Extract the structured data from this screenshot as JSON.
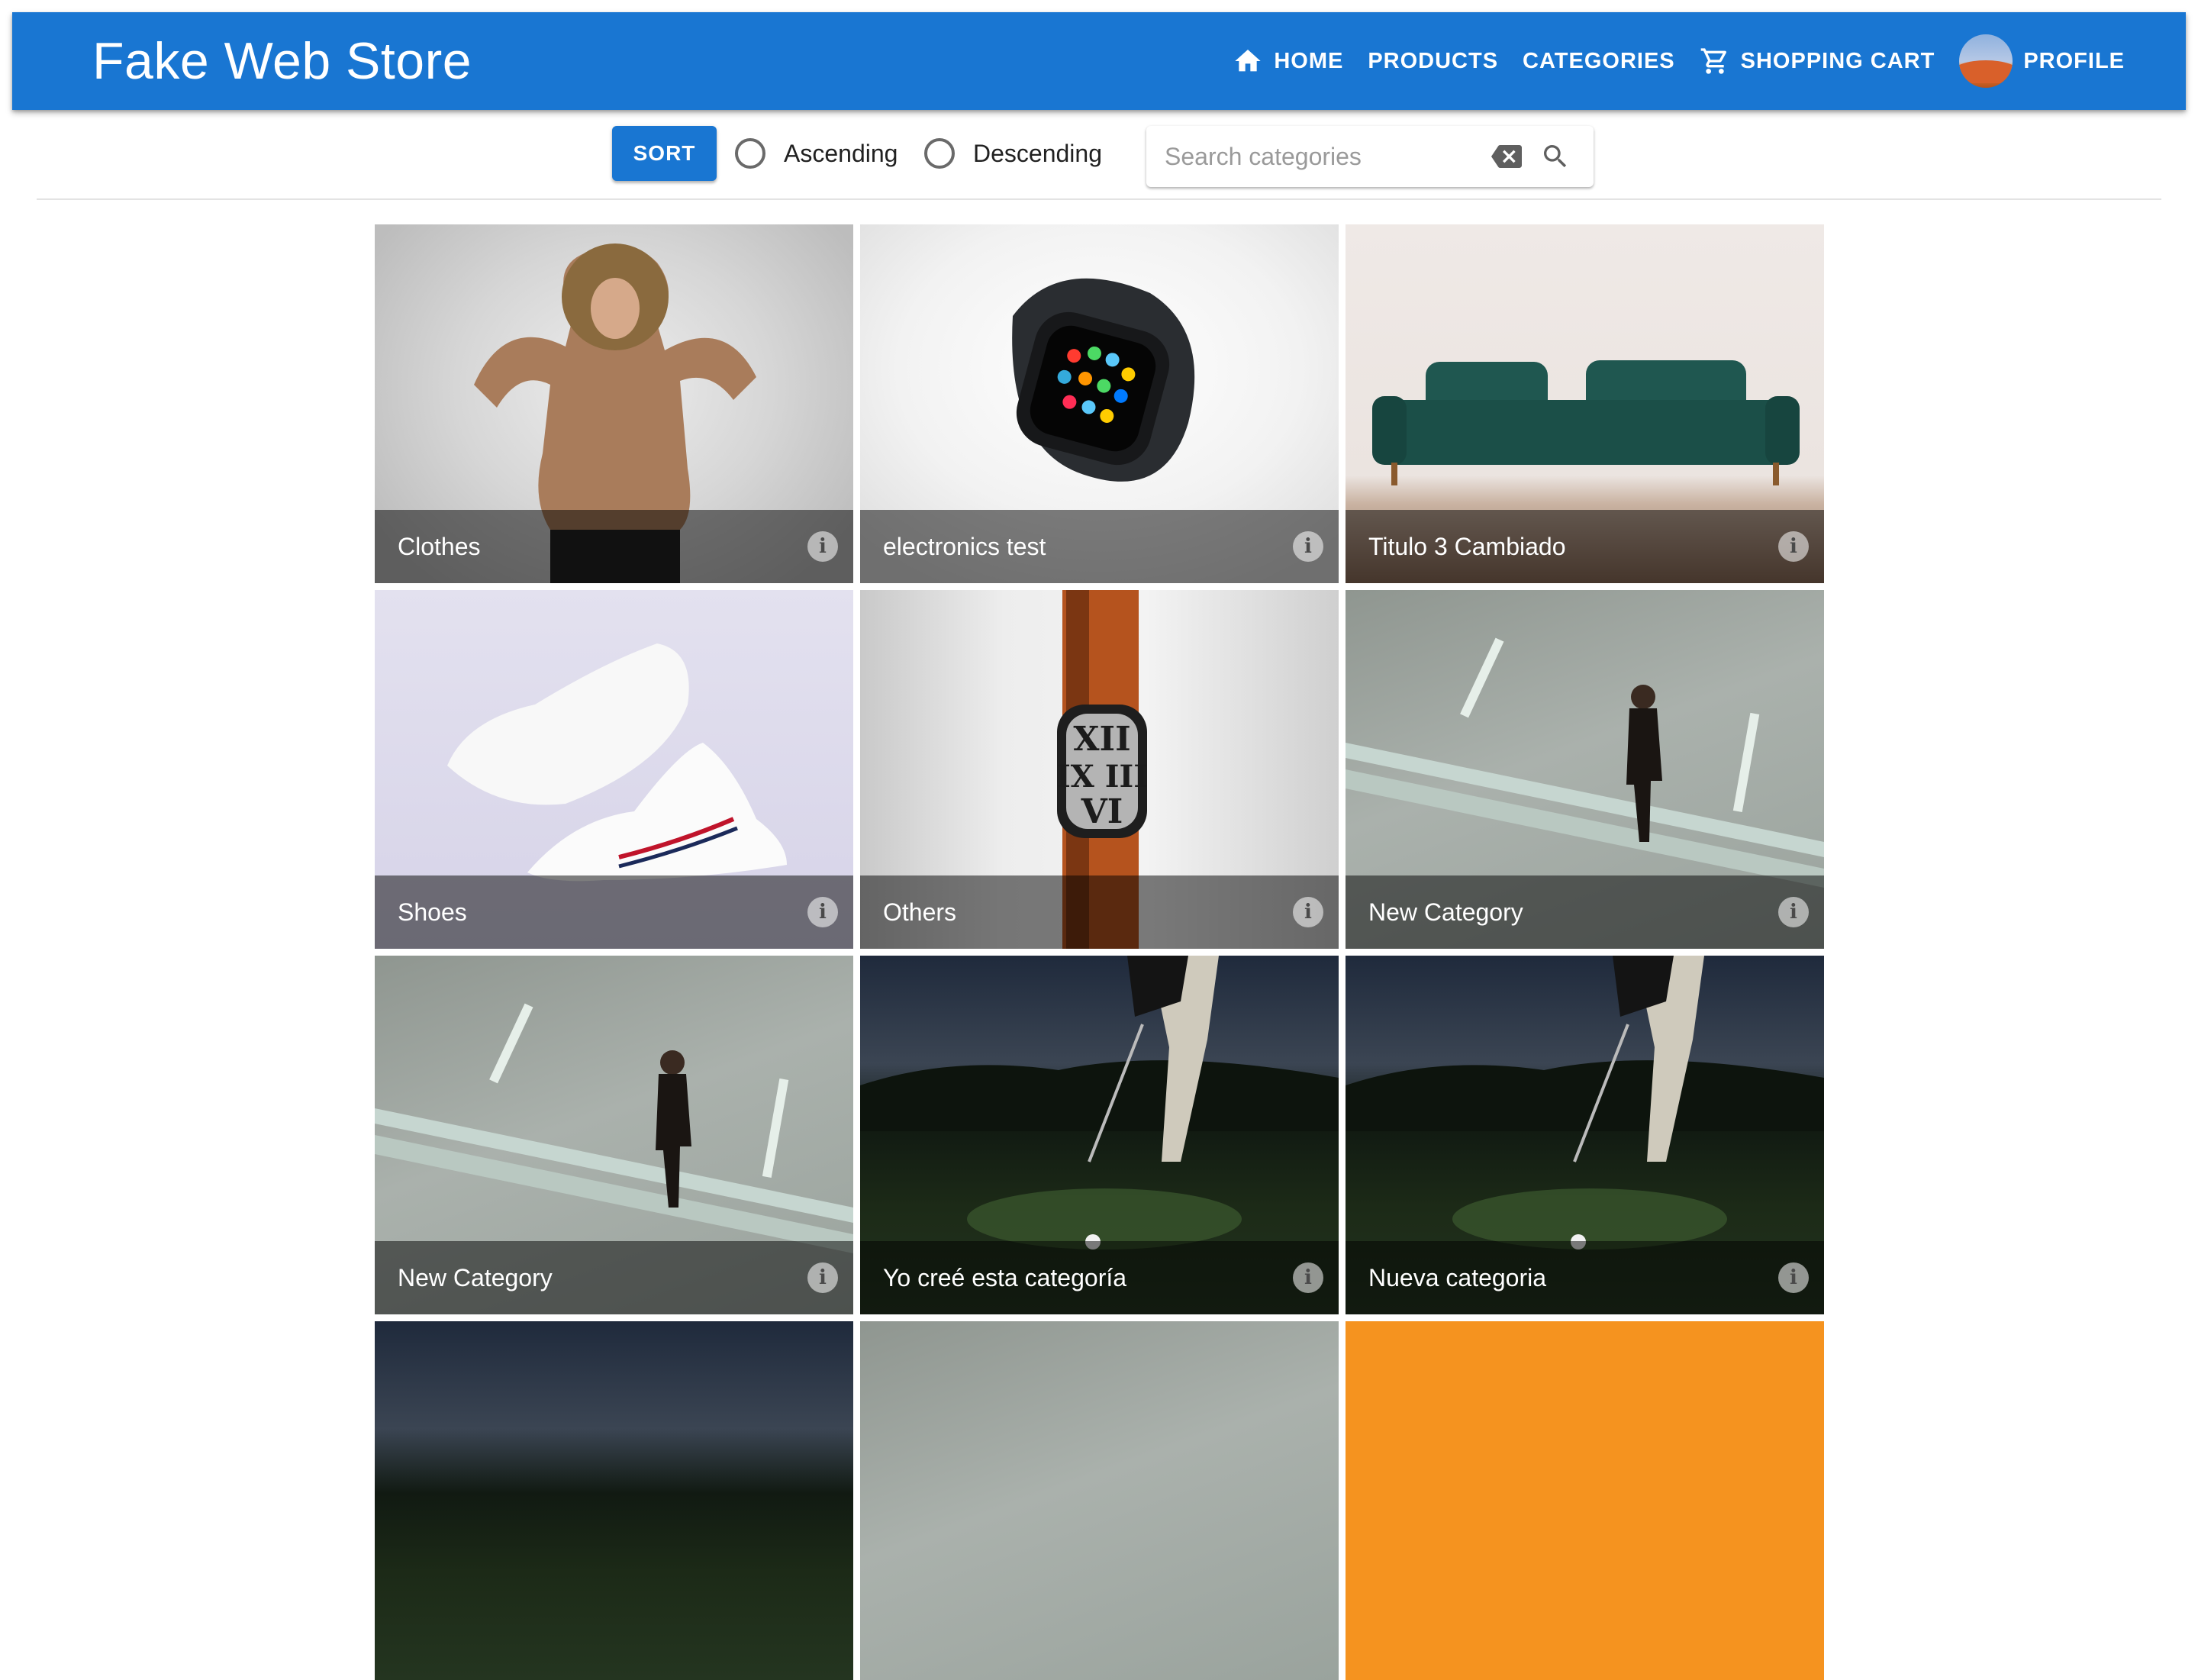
{
  "app": {
    "title": "Fake Web Store"
  },
  "nav": {
    "home": "HOME",
    "products": "PRODUCTS",
    "categories": "CATEGORIES",
    "cart": "SHOPPING CART",
    "profile": "PROFILE"
  },
  "toolbar": {
    "sort_label": "SORT",
    "ascending_label": "Ascending",
    "descending_label": "Descending",
    "search_placeholder": "Search categories",
    "search_value": ""
  },
  "categories": [
    {
      "title": "Clothes",
      "image": "clothes"
    },
    {
      "title": "electronics test",
      "image": "watch"
    },
    {
      "title": "Titulo 3 Cambiado",
      "image": "sofa"
    },
    {
      "title": "Shoes",
      "image": "shoes"
    },
    {
      "title": "Others",
      "image": "watch-orange-band"
    },
    {
      "title": "New Category",
      "image": "man-on-road"
    },
    {
      "title": "New Category",
      "image": "man-on-road"
    },
    {
      "title": "Yo creé esta categoría",
      "image": "golfer"
    },
    {
      "title": "Nueva categoria",
      "image": "golfer"
    },
    {
      "title": "",
      "image": "dark"
    },
    {
      "title": "",
      "image": "grey"
    },
    {
      "title": "",
      "image": "orange"
    }
  ],
  "icons": {
    "home": "home-icon",
    "cart": "shopping-cart-icon",
    "clear": "backspace-icon",
    "search": "search-icon",
    "info": "info-icon"
  },
  "colors": {
    "primary": "#1976d2",
    "orange_tile": "#f5931f"
  }
}
